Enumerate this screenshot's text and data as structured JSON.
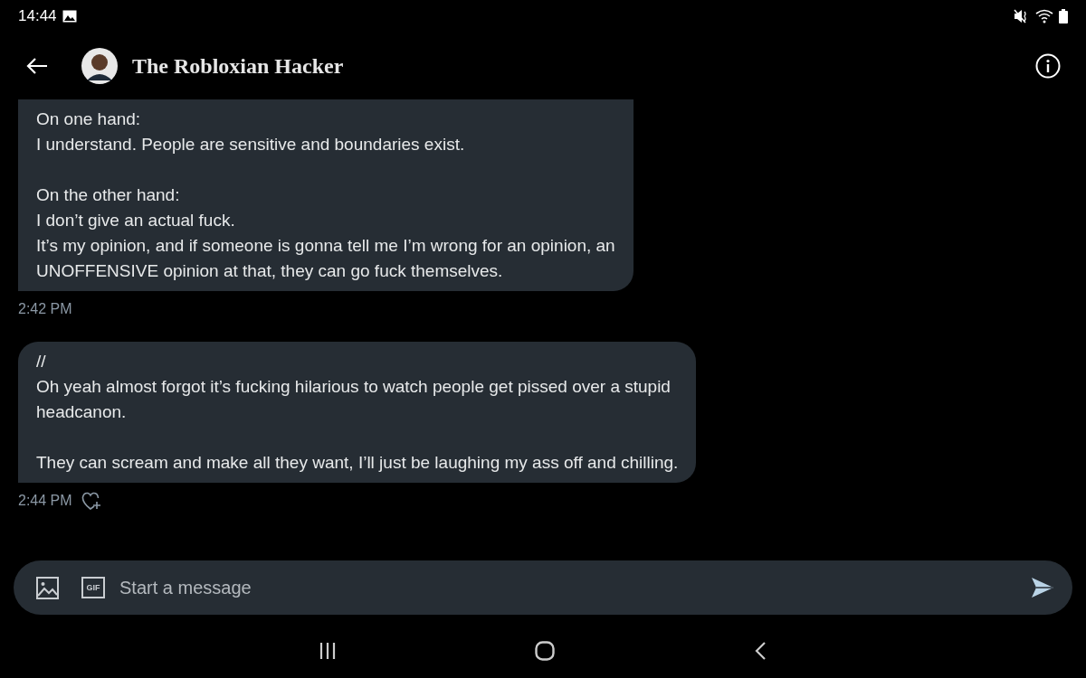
{
  "status_bar": {
    "time": "14:44"
  },
  "header": {
    "title": "The Robloxian Hacker"
  },
  "messages": [
    {
      "paragraphs": [
        [
          "On one hand:",
          "I understand. People are sensitive and boundaries exist."
        ],
        [
          "On the other hand:",
          "I don’t give an actual fuck.",
          "It’s my opinion, and if someone is gonna tell me I’m wrong for an opinion, an",
          "UNOFFENSIVE opinion at that, they can go fuck themselves."
        ]
      ],
      "time": "2:42 PM",
      "react_button": false
    },
    {
      "paragraphs": [
        [
          "//",
          "Oh yeah almost forgot it’s fucking hilarious to watch people get pissed over a stupid",
          "headcanon."
        ],
        [
          "They can scream and make all they want, I’ll just be laughing my ass off and chilling."
        ]
      ],
      "time": "2:44 PM",
      "react_button": true
    }
  ],
  "composer": {
    "gif_label": "GIF",
    "placeholder": "Start a message"
  }
}
